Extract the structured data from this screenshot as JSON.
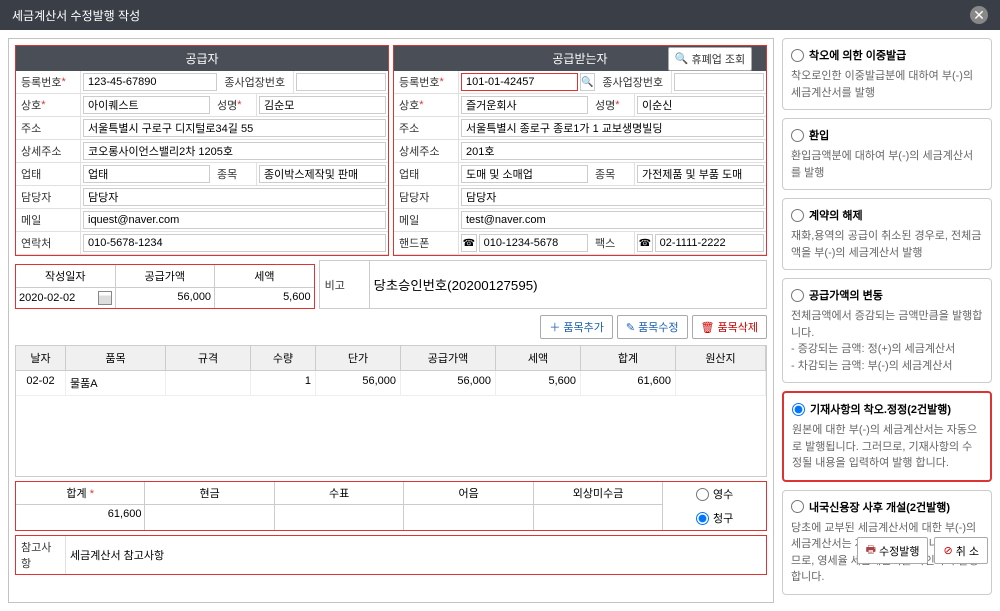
{
  "title": "세금계산서 수정발행 작성",
  "supplier": {
    "header": "공급자",
    "regNo_label": "등록번호",
    "regNo": "123-45-67890",
    "subBizNo_label": "종사업장번호",
    "subBizNo": "",
    "company_label": "상호",
    "company": "아이퀘스트",
    "name_label": "성명",
    "name": "김순모",
    "address_label": "주소",
    "address": "서울특별시 구로구 디지털로34길 55",
    "detailAddr_label": "상세주소",
    "detailAddr": "코오롱사이언스밸리2차 1205호",
    "bizType_label": "업태",
    "bizType": "업태",
    "bizItem_label": "종목",
    "bizItem": "종이박스제작및 판매",
    "manager_label": "담당자",
    "manager": "담당자",
    "email_label": "메일",
    "email": "iquest@naver.com",
    "contact_label": "연락처",
    "contact": "010-5678-1234"
  },
  "recipient": {
    "header": "공급받는자",
    "lookupBtn": "휴폐업 조회",
    "regNo_label": "등록번호",
    "regNo": "101-01-42457",
    "subBizNo_label": "종사업장번호",
    "subBizNo": "",
    "company_label": "상호",
    "company": "즐거운회사",
    "name_label": "성명",
    "name": "이순신",
    "address_label": "주소",
    "address": "서울특별시 종로구 종로1가 1 교보생명빌딩",
    "detailAddr_label": "상세주소",
    "detailAddr": "201호",
    "bizType_label": "업태",
    "bizType": "도매 및 소매업",
    "bizItem_label": "종목",
    "bizItem": "가전제품 및 부품 도매",
    "manager_label": "담당자",
    "manager": "담당자",
    "email_label": "메일",
    "email": "test@naver.com",
    "phone_label": "핸드폰",
    "phone": "010-1234-5678",
    "fax_label": "팩스",
    "fax": "02-1111-2222"
  },
  "summary": {
    "date_label": "작성일자",
    "date": "2020-02-02",
    "supplyAmt_label": "공급가액",
    "supplyAmt": "56,000",
    "tax_label": "세액",
    "tax": "5,600",
    "remarks_label": "비고",
    "remarks": "당초승인번호(20200127595)"
  },
  "toolbar": {
    "addItem": "품목추가",
    "editItem": "품목수정",
    "deleteItem": "품목삭제"
  },
  "grid": {
    "headers": [
      "날자",
      "품목",
      "규격",
      "수량",
      "단가",
      "공급가액",
      "세액",
      "합계",
      "원산지"
    ],
    "rows": [
      {
        "date": "02-02",
        "item": "물품A",
        "spec": "",
        "qty": "1",
        "price": "56,000",
        "supply": "56,000",
        "tax": "5,600",
        "total": "61,600",
        "origin": ""
      }
    ]
  },
  "totals": {
    "total_label": "합계",
    "total": "61,600",
    "cash_label": "현금",
    "cash": "",
    "check_label": "수표",
    "check": "",
    "bill_label": "어음",
    "bill": "",
    "credit_label": "외상미수금",
    "credit": "",
    "receipt": "영수",
    "claim": "청구"
  },
  "notes": {
    "label": "참고사항",
    "value": "세금계산서 참고사항"
  },
  "options": [
    {
      "title": "착오에 의한 이중발급",
      "desc": "착오로인한 이중발급분에 대하여 부(-)의 세금계산서를 발행",
      "selected": false
    },
    {
      "title": "환입",
      "desc": "환입금액분에 대하여 부(-)의 세금계산서를 발행",
      "selected": false
    },
    {
      "title": "계약의 해제",
      "desc": "재화,용역의 공급이 취소된 경우로, 전체금액을 부(-)의 세금계산서 발행",
      "selected": false
    },
    {
      "title": "공급가액의 변동",
      "desc": "전체금액에서 증감되는 금액만큼을 발행합니다.\n- 증강되는 금액: 정(+)의 세금계산서\n- 차감되는 금액: 부(-)의 세금계산서",
      "selected": false
    },
    {
      "title": "기재사항의 착오.정정(2건발행)",
      "desc": "원본에 대한 부(-)의 세금계산서는 자동으로 발행됩니다. 그러므로, 기재사항의 수정될 내용을 입력하여 발행 합니다.",
      "selected": true
    },
    {
      "title": "내국신용장 사후 개설(2건발행)",
      "desc": "당초에 교부된 세금계산서에 대한 부(-)의 세금계산서는 자동으로 발행됩니다. 그러므로, 영세율 세금계산서를 확인하여 발행합니다.",
      "selected": false
    }
  ],
  "footer": {
    "issue": "수정발행",
    "cancel": "취 소"
  }
}
